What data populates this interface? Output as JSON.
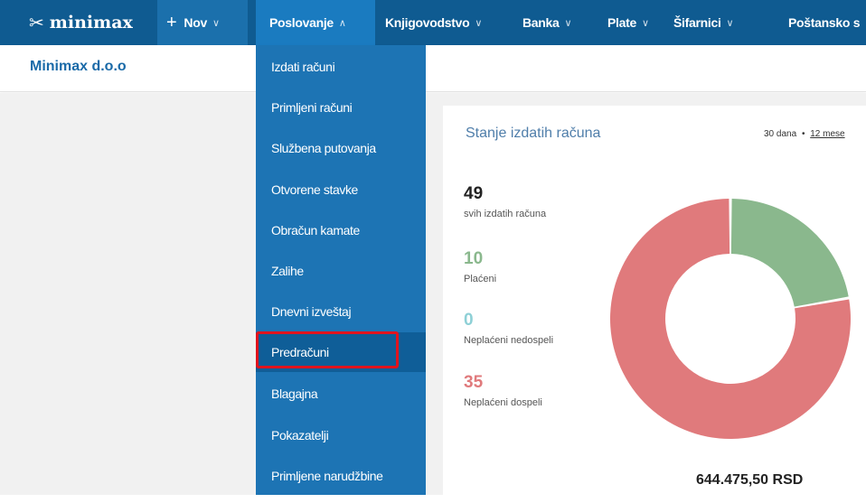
{
  "topnav": {
    "logo": "minimax",
    "new_label": "Nov",
    "items": [
      "Poslovanje",
      "Knjigovodstvo",
      "Banka",
      "Plate",
      "Šifarnici",
      "Poštansko s"
    ]
  },
  "company": "Minimax d.o.o",
  "menu": {
    "items": [
      "Izdati računi",
      "Primljeni računi",
      "Službena putovanja",
      "Otvorene stavke",
      "Obračun kamate",
      "Zalihe",
      "Dnevni izveštaj",
      "Predračuni",
      "Blagajna",
      "Pokazatelji",
      "Primljene narudžbine"
    ],
    "selected": "Predračuni"
  },
  "card": {
    "title": "Stanje izdatih računa",
    "range_30": "30 dana",
    "range_sep": "•",
    "range_12": "12 mese",
    "stats": [
      {
        "value": "49",
        "label": "svih izdatih računa",
        "color": "#222222"
      },
      {
        "value": "10",
        "label": "Plaćeni",
        "color": "#8ab88d"
      },
      {
        "value": "0",
        "label": "Neplaćeni nedospeli",
        "color": "#8ed0d6"
      },
      {
        "value": "35",
        "label": "Neplaćeni dospeli",
        "color": "#e07a7c"
      }
    ],
    "total": "644.475,50 RSD"
  },
  "colors": {
    "nav_bg": "#0f5b91",
    "menu_bg": "#1d74b4",
    "paid": "#8ab88d",
    "unpaid_overdue": "#e07a7c",
    "highlight": "#e0141e"
  },
  "chart_data": {
    "type": "pie",
    "categories": [
      "Plaćeni",
      "Neplaćeni nedospeli",
      "Neplaćeni dospeli"
    ],
    "values": [
      10,
      0,
      35
    ]
  }
}
